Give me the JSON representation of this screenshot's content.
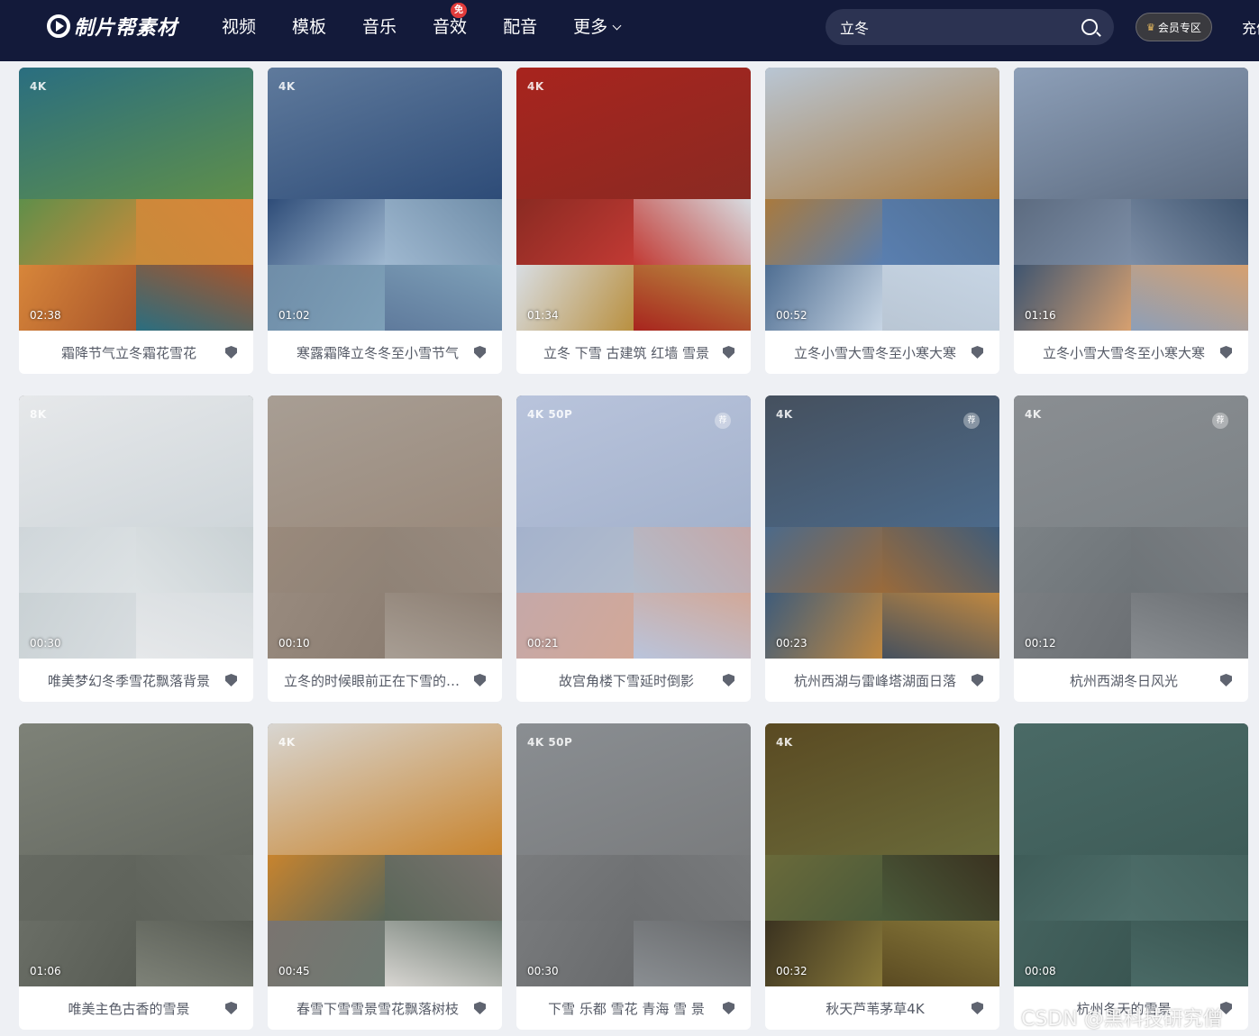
{
  "header": {
    "logo_text": "制片帮素材",
    "nav": [
      {
        "label": "视频"
      },
      {
        "label": "模板"
      },
      {
        "label": "音乐"
      },
      {
        "label": "音效",
        "badge": "免"
      },
      {
        "label": "配音"
      },
      {
        "label": "更多",
        "dropdown": true
      }
    ],
    "search_value": "立冬",
    "vip_label": "会员专区",
    "recharge_label": "充值"
  },
  "cards": [
    {
      "title": "霜降节气立冬霜花雪花",
      "tag": "4K",
      "duration": "02:38",
      "colors": [
        "#2a6e80",
        "#5f8f4a",
        "#c88a3a",
        "#d7863a",
        "#a8542a"
      ]
    },
    {
      "title": "寒露霜降立冬冬至小雪节气",
      "tag": "4K",
      "duration": "01:02",
      "colors": [
        "#5f7a9c",
        "#2e4c78",
        "#9fb8d0",
        "#6f8da8",
        "#7ea0b8"
      ]
    },
    {
      "title": "立冬 下雪 古建筑 红墙 雪景",
      "tag": "4K",
      "duration": "01:34",
      "colors": [
        "#a8241e",
        "#8a2a22",
        "#c23a34",
        "#d8dde2",
        "#b99040"
      ]
    },
    {
      "title": "立冬小雪大雪冬至小寒大寒",
      "tag": "",
      "duration": "00:52",
      "colors": [
        "#b9c6d4",
        "#a97a3e",
        "#5a7fb0",
        "#4f6e92",
        "#c7d5e4"
      ]
    },
    {
      "title": "立冬小雪大雪冬至小寒大寒",
      "tag": "",
      "duration": "01:16",
      "colors": [
        "#8d9fb8",
        "#5c6b80",
        "#7d8ea6",
        "#3f5570",
        "#d6a070"
      ]
    },
    {
      "title": "唯美梦幻冬季雪花飘落背景",
      "tag": "8K",
      "duration": "00:30",
      "colors": [
        "#e6e8ea",
        "#cfd6da",
        "#dde2e4",
        "#c9d1d4",
        "#d8dde0"
      ]
    },
    {
      "title": "立冬的时候眼前正在下雪的场景",
      "tag": "",
      "duration": "00:10",
      "colors": [
        "#a89e94",
        "#9a8a7c",
        "#8f8276",
        "#988a7e",
        "#8c7e72"
      ]
    },
    {
      "title": "故宫角楼下雪延时倒影",
      "tag": "4K 50P",
      "duration": "00:21",
      "stamp": "荐",
      "colors": [
        "#b9c4dc",
        "#a4b2cc",
        "#b2bccc",
        "#c5a8a8",
        "#d2a898"
      ]
    },
    {
      "title": "杭州西湖与雷峰塔湖面日落",
      "tag": "4K",
      "duration": "00:23",
      "stamp": "荐",
      "colors": [
        "#45505e",
        "#4c6a8a",
        "#9a6a3a",
        "#3f5c7a",
        "#c08840"
      ]
    },
    {
      "title": "杭州西湖冬日风光",
      "tag": "4K",
      "duration": "00:12",
      "stamp": "荐",
      "colors": [
        "#8a8e92",
        "#7c8286",
        "#6e7478",
        "#7a7e82",
        "#6c7074"
      ]
    },
    {
      "title": "唯美主色古香的雪景",
      "tag": "",
      "duration": "01:06",
      "colors": [
        "#7e8278",
        "#666a62",
        "#5e625a",
        "#6a6e66",
        "#585c54"
      ]
    },
    {
      "title": "春雪下雪雪景雪花飘落树枝",
      "tag": "4K",
      "duration": "00:45",
      "colors": [
        "#d8d6d2",
        "#c8842e",
        "#5a6658",
        "#7a7470",
        "#6e7a72"
      ]
    },
    {
      "title": "下雪 乐都 雪花 青海 雪 景",
      "tag": "4K 50P",
      "duration": "00:30",
      "colors": [
        "#8a8e92",
        "#7a7c7e",
        "#6c6e70",
        "#787a7c",
        "#686a6c"
      ]
    },
    {
      "title": "秋天芦苇茅草4K",
      "tag": "4K",
      "duration": "00:32",
      "colors": [
        "#5a4a22",
        "#6a6a3a",
        "#4a5a3a",
        "#3a3220",
        "#8a7a3a"
      ]
    },
    {
      "title": "杭州冬天的雪景",
      "tag": "",
      "duration": "00:08",
      "colors": [
        "#4a6a66",
        "#3e5c58",
        "#4e6e6a",
        "#44625e",
        "#3a5652"
      ]
    }
  ],
  "watermark": "CSDN @黑科技研究僧"
}
